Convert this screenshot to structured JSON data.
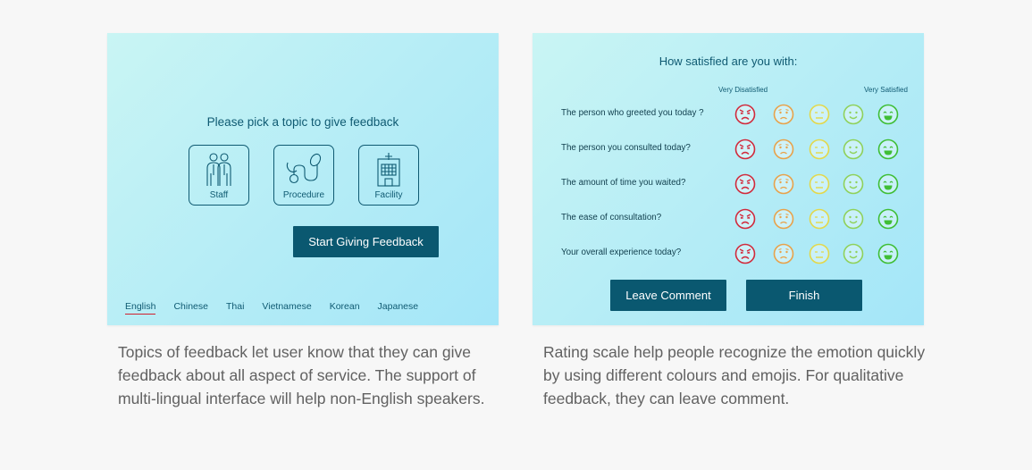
{
  "left_panel": {
    "title": "Please pick a topic to give feedback",
    "topics": [
      {
        "label": "Staff",
        "icon": "staff-icon"
      },
      {
        "label": "Procedure",
        "icon": "stethoscope-icon"
      },
      {
        "label": "Facility",
        "icon": "hospital-icon"
      }
    ],
    "start_button": "Start Giving Feedback",
    "languages": [
      "English",
      "Chinese",
      "Thai",
      "Vietnamese",
      "Korean",
      "Japanese"
    ],
    "active_language": "English"
  },
  "right_panel": {
    "title": "How satisfied are you with:",
    "scale_low": "Very Disatisfied",
    "scale_high": "Very Satisfied",
    "questions": [
      "The person who greeted you today ?",
      "The person you consulted today?",
      "The amount of time you waited?",
      "The ease of consultation?",
      "Your overall experience today?"
    ],
    "ratings": [
      {
        "name": "very-dissatisfied",
        "icon": "angry-face-icon",
        "color": "#d12a3c"
      },
      {
        "name": "dissatisfied",
        "icon": "sad-face-icon",
        "color": "#e8a24a"
      },
      {
        "name": "neutral",
        "icon": "neutral-face-icon",
        "color": "#e3d84a"
      },
      {
        "name": "satisfied",
        "icon": "smile-face-icon",
        "color": "#8fd15a"
      },
      {
        "name": "very-satisfied",
        "icon": "grin-face-icon",
        "color": "#3fbe35"
      }
    ],
    "leave_comment_button": "Leave Comment",
    "finish_button": "Finish"
  },
  "captions": {
    "left": "Topics of feedback let user know that they can give feedback about all aspect of service. The support of multi-lingual interface will help non-English speakers.",
    "right": "Rating scale help people recognize the emotion quickly by using different colours and emojis. For qualitative feedback, they can leave comment."
  },
  "colors": {
    "accent": "#0a5870",
    "active_underline": "#d0202e"
  }
}
